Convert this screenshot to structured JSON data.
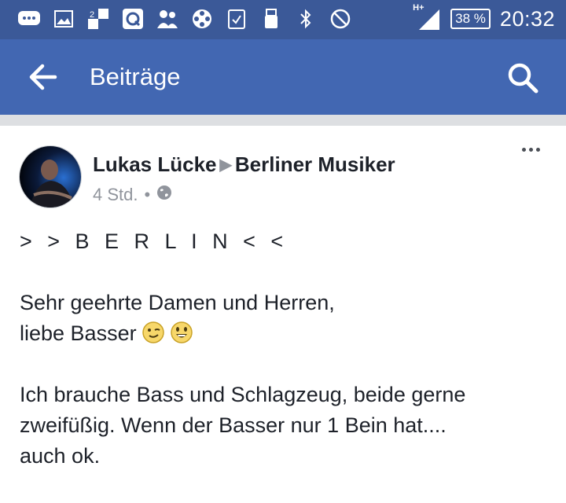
{
  "status_bar": {
    "network": "H+",
    "battery": "38 %",
    "time": "20:32"
  },
  "app_bar": {
    "title": "Beiträge"
  },
  "post": {
    "author": "Lukas Lücke",
    "target_group": "Berliner Musiker",
    "time": "4 Std.",
    "visibility_separator": "•",
    "lines": {
      "headline": "> > B E R L I N < <",
      "greeting1": "Sehr geehrte Damen und Herren,",
      "greeting2": "liebe Basser",
      "body1": "Ich brauche Bass und Schlagzeug, beide gerne",
      "body2": "zweifüßig. Wenn der Basser nur 1 Bein hat....",
      "body3": "auch ok."
    }
  },
  "colors": {
    "status_bar": "#3b5998",
    "app_bar": "#4267b2",
    "separator": "#dddfe2",
    "meta_text": "#90949c"
  }
}
